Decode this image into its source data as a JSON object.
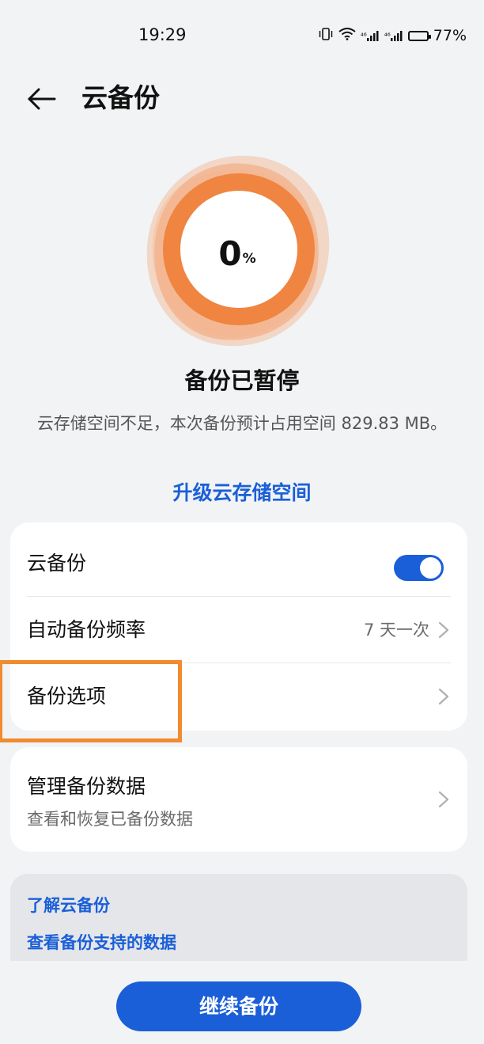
{
  "status_bar": {
    "time": "19:29",
    "network_1": "⁴⁶",
    "network_2": "⁴⁶",
    "battery": "77%"
  },
  "header": {
    "title": "云备份"
  },
  "progress": {
    "value": "0",
    "unit": "%",
    "fraction": 0
  },
  "status": {
    "title": "备份已暂停",
    "description": "云存储空间不足，本次备份预计占用空间 829.83 MB。",
    "upgrade_link": "升级云存储空间"
  },
  "settings": {
    "cloud_backup_label": "云备份",
    "cloud_backup_enabled": true,
    "auto_frequency_label": "自动备份频率",
    "auto_frequency_value": "7 天一次",
    "backup_options_label": "备份选项"
  },
  "manage": {
    "title": "管理备份数据",
    "subtitle": "查看和恢复已备份数据"
  },
  "info": {
    "learn_link": "了解云备份",
    "supported_link": "查看备份支持的数据"
  },
  "actions": {
    "continue_label": "继续备份"
  },
  "colors": {
    "accent": "#1a5fd8",
    "ring": "#f08a3c",
    "highlight": "#f28a2e",
    "background": "#f1f3f5"
  }
}
